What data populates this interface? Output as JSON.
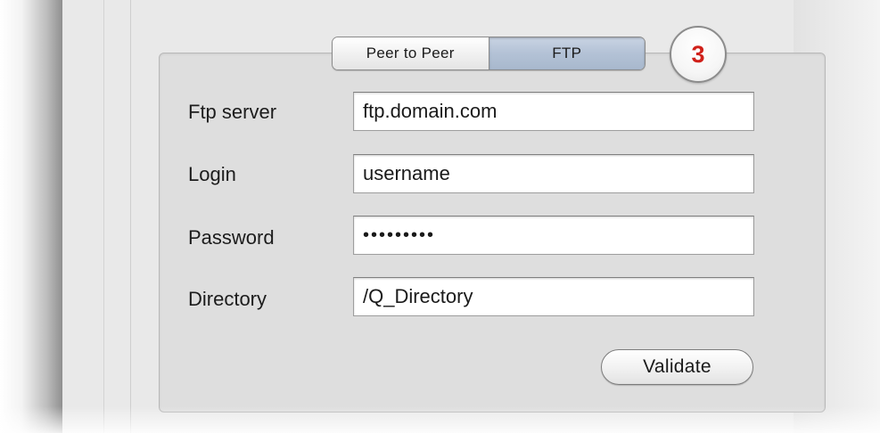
{
  "segmented_control": {
    "options": [
      "Peer to Peer",
      "FTP"
    ],
    "selected": "FTP"
  },
  "step_badge": "3",
  "form": {
    "fields": [
      {
        "label": "Ftp server",
        "value": "ftp.domain.com"
      },
      {
        "label": "Login",
        "value": "username"
      },
      {
        "label": "Password",
        "value": "•••••••••"
      },
      {
        "label": "Directory",
        "value": "/Q_Directory"
      }
    ],
    "validate_label": "Validate"
  },
  "colors": {
    "badge_number": "#d0211a",
    "selected_segment": "#b3c2d6",
    "panel_background": "#dedede"
  }
}
